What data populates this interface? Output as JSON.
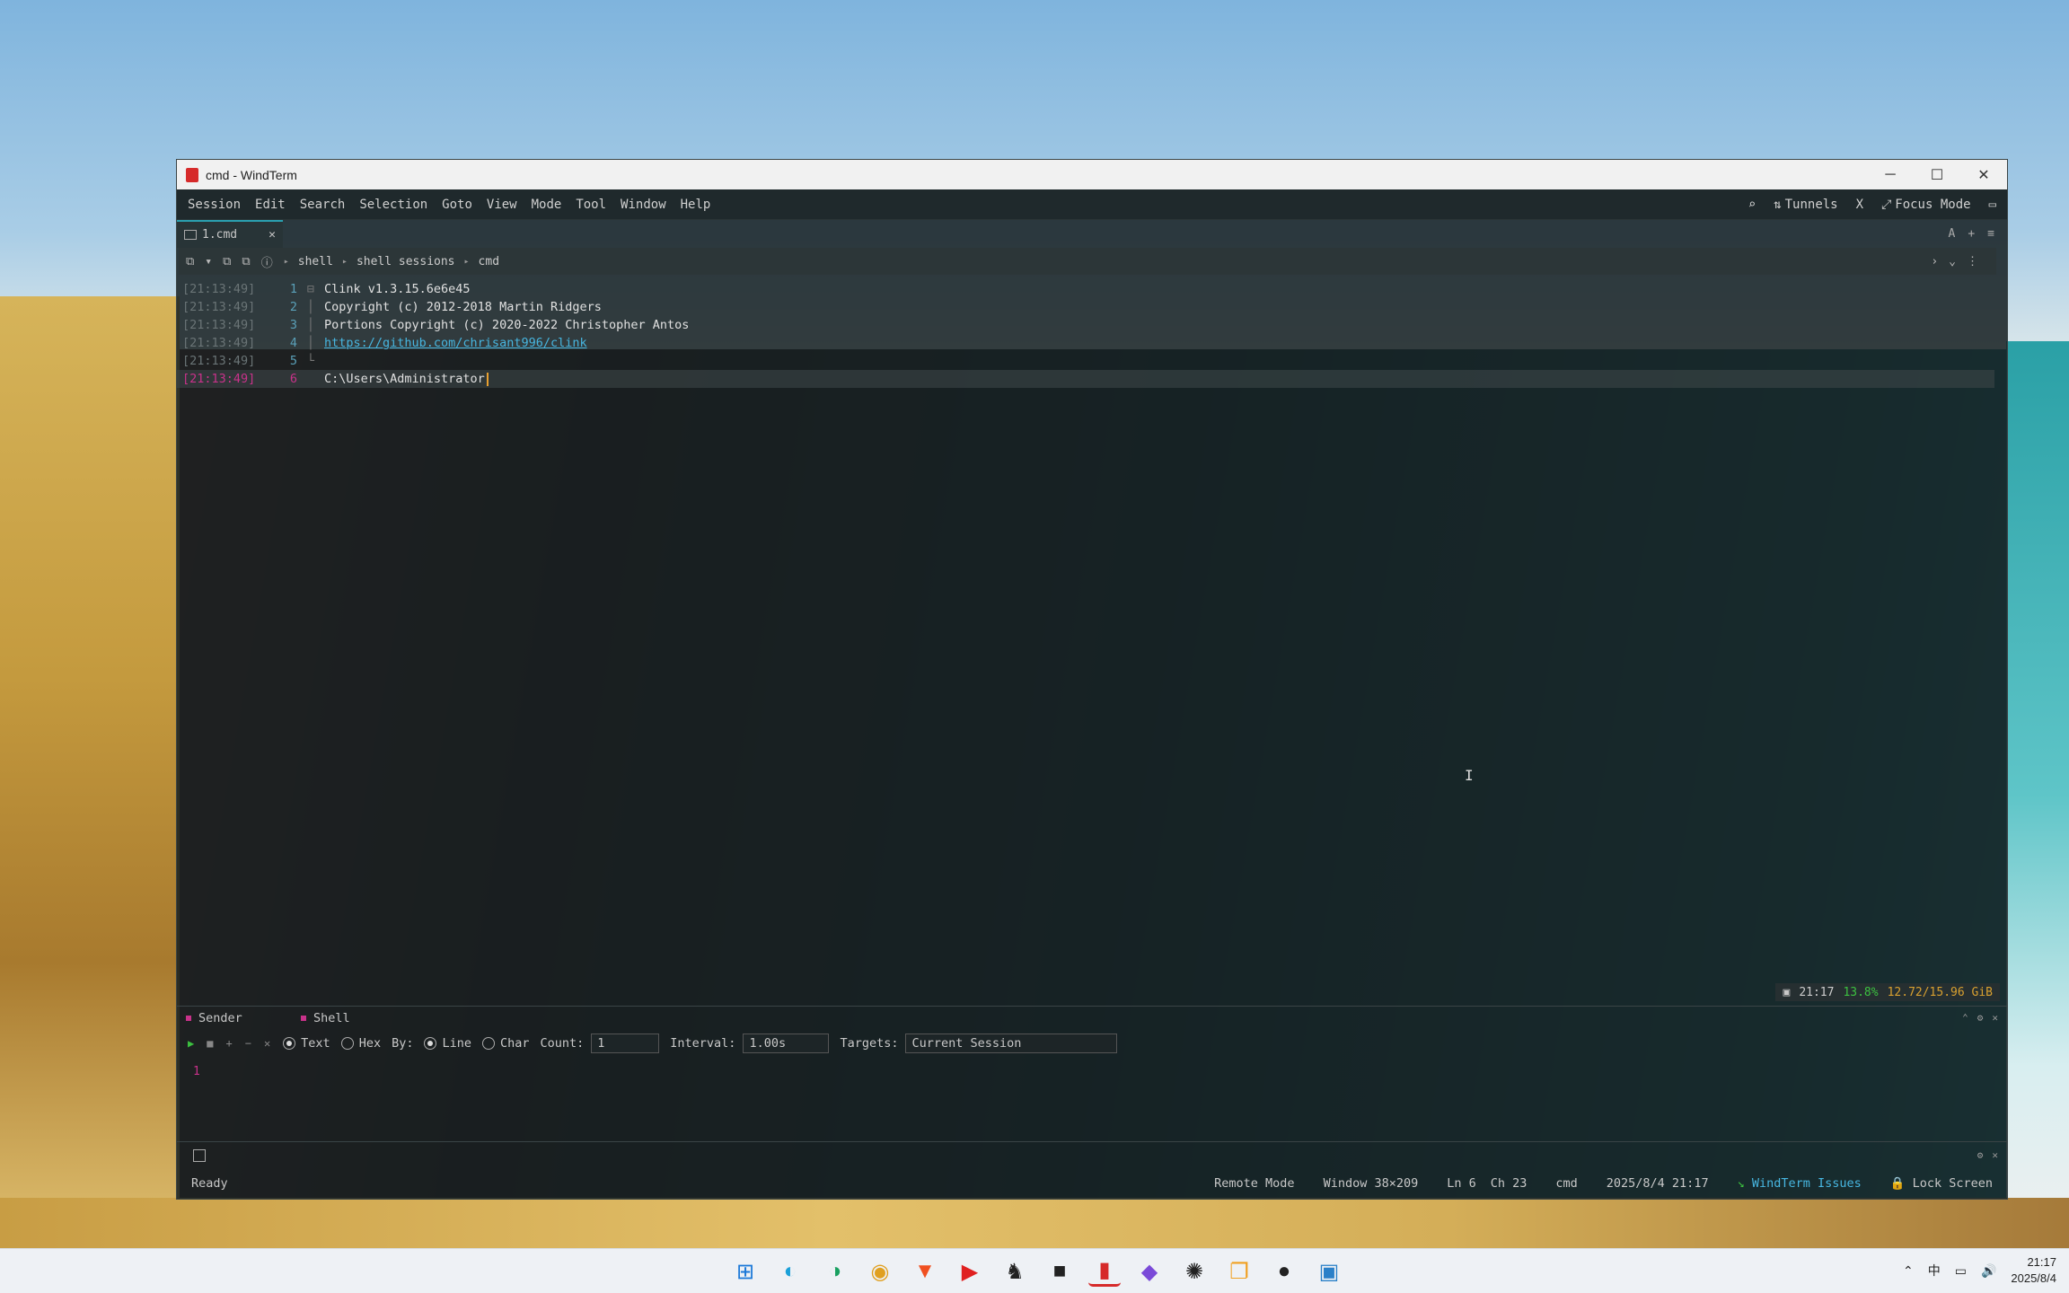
{
  "window": {
    "title": "cmd - WindTerm",
    "controls": {
      "minimize": "─",
      "maximize": "☐",
      "close": "✕"
    }
  },
  "menu": {
    "items": [
      "Session",
      "Edit",
      "Search",
      "Selection",
      "Goto",
      "View",
      "Mode",
      "Tool",
      "Window",
      "Help"
    ],
    "right": {
      "search_icon": "⌕",
      "tunnels": "Tunnels",
      "x_label": "X",
      "focus_mode": "Focus Mode"
    }
  },
  "tabs": [
    {
      "label": "1.cmd",
      "close": "✕"
    }
  ],
  "tabbar_right": {
    "a": "A",
    "plus": "+",
    "menu": "≡"
  },
  "breadcrumbs": [
    "shell",
    "shell sessions",
    "cmd"
  ],
  "terminal": {
    "lines": [
      {
        "ts": "[21:13:49]",
        "ln": "1",
        "text": "Clink v1.3.15.6e6e45",
        "fold": "⊟"
      },
      {
        "ts": "[21:13:49]",
        "ln": "2",
        "text": "Copyright (c) 2012-2018 Martin Ridgers",
        "fold": "│"
      },
      {
        "ts": "[21:13:49]",
        "ln": "3",
        "text": "Portions Copyright (c) 2020-2022 Christopher Antos",
        "fold": "│"
      },
      {
        "ts": "[21:13:49]",
        "ln": "4",
        "text": "https://github.com/chrisant996/clink",
        "fold": "│",
        "link": true
      },
      {
        "ts": "[21:13:49]",
        "ln": "5",
        "text": "",
        "fold": "└"
      },
      {
        "ts": "[21:13:49]",
        "ln": "6",
        "text": "C:\\Users\\Administrator",
        "fold": "",
        "current": true
      }
    ]
  },
  "mini_status": {
    "time": "21:17",
    "cpu": "13.8%",
    "mem": "12.72/15.96 GiB"
  },
  "sender": {
    "tabs": [
      "Sender",
      "Shell"
    ],
    "text_label": "Text",
    "hex_label": "Hex",
    "by_label": "By:",
    "line_label": "Line",
    "char_label": "Char",
    "count_label": "Count:",
    "count_value": "1",
    "interval_label": "Interval:",
    "interval_value": "1.00s",
    "targets_label": "Targets:",
    "targets_value": "Current Session",
    "editor_line": "1"
  },
  "statusbar": {
    "ready": "Ready",
    "remote_mode": "Remote Mode",
    "window_size": "Window 38×209",
    "ln": "Ln 6",
    "ch": "Ch 23",
    "shell": "cmd",
    "datetime": "2025/8/4 21:17",
    "issues": "WindTerm Issues",
    "lock": "Lock Screen"
  },
  "taskbar": {
    "clock_time": "21:17",
    "clock_date": "2025/8/4",
    "ime": "中"
  },
  "colors": {
    "accent": "#2aa0b0",
    "link": "#47b6e0",
    "current_line": "#c8328a",
    "cursor": "#e8a030"
  }
}
